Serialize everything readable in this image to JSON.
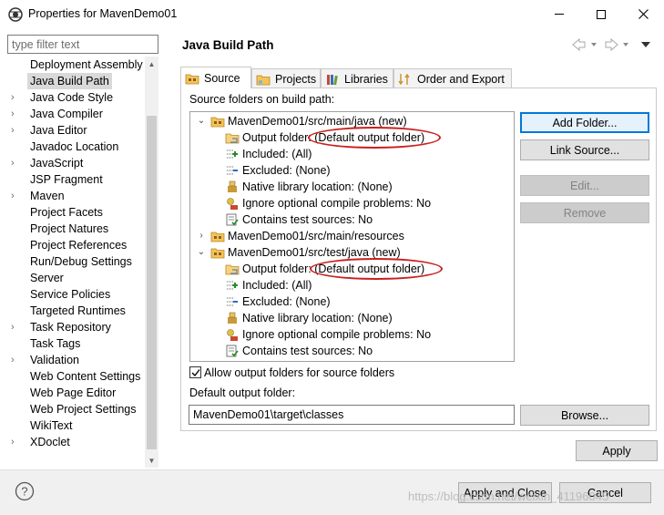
{
  "window": {
    "title": "Properties for MavenDemo01",
    "minimize_glyph": "─",
    "maximize_glyph": "☐",
    "close_glyph": "✕"
  },
  "filter": {
    "placeholder": "type filter text"
  },
  "left_tree": [
    {
      "label": "Deployment Assembly",
      "expandable": false,
      "selected": false
    },
    {
      "label": "Java Build Path",
      "expandable": false,
      "selected": true
    },
    {
      "label": "Java Code Style",
      "expandable": true,
      "selected": false
    },
    {
      "label": "Java Compiler",
      "expandable": true,
      "selected": false
    },
    {
      "label": "Java Editor",
      "expandable": true,
      "selected": false
    },
    {
      "label": "Javadoc Location",
      "expandable": false,
      "selected": false
    },
    {
      "label": "JavaScript",
      "expandable": true,
      "selected": false
    },
    {
      "label": "JSP Fragment",
      "expandable": false,
      "selected": false
    },
    {
      "label": "Maven",
      "expandable": true,
      "selected": false
    },
    {
      "label": "Project Facets",
      "expandable": false,
      "selected": false
    },
    {
      "label": "Project Natures",
      "expandable": false,
      "selected": false
    },
    {
      "label": "Project References",
      "expandable": false,
      "selected": false
    },
    {
      "label": "Run/Debug Settings",
      "expandable": false,
      "selected": false
    },
    {
      "label": "Server",
      "expandable": false,
      "selected": false
    },
    {
      "label": "Service Policies",
      "expandable": false,
      "selected": false
    },
    {
      "label": "Targeted Runtimes",
      "expandable": false,
      "selected": false
    },
    {
      "label": "Task Repository",
      "expandable": true,
      "selected": false
    },
    {
      "label": "Task Tags",
      "expandable": false,
      "selected": false
    },
    {
      "label": "Validation",
      "expandable": true,
      "selected": false
    },
    {
      "label": "Web Content Settings",
      "expandable": false,
      "selected": false
    },
    {
      "label": "Web Page Editor",
      "expandable": false,
      "selected": false
    },
    {
      "label": "Web Project Settings",
      "expandable": false,
      "selected": false
    },
    {
      "label": "WikiText",
      "expandable": false,
      "selected": false
    },
    {
      "label": "XDoclet",
      "expandable": true,
      "selected": false
    }
  ],
  "page": {
    "title": "Java Build Path"
  },
  "tabs": [
    {
      "label": "Source",
      "active": true,
      "icon": "source-folder-icon"
    },
    {
      "label": "Projects",
      "active": false,
      "icon": "projects-icon"
    },
    {
      "label": "Libraries",
      "active": false,
      "icon": "libraries-icon"
    },
    {
      "label": "Order and Export",
      "active": false,
      "icon": "order-export-icon"
    }
  ],
  "source": {
    "label": "Source folders on build path:",
    "rows": [
      {
        "level": 0,
        "expander": "open",
        "icon": "package-folder-icon",
        "text": "MavenDemo01/src/main/java (new)"
      },
      {
        "level": 1,
        "expander": "none",
        "icon": "output-folder-icon",
        "text": "Output folder: (Default output folder)"
      },
      {
        "level": 1,
        "expander": "none",
        "icon": "included-icon",
        "text": "Included: (All)"
      },
      {
        "level": 1,
        "expander": "none",
        "icon": "excluded-icon",
        "text": "Excluded: (None)"
      },
      {
        "level": 1,
        "expander": "none",
        "icon": "native-library-icon",
        "text": "Native library location: (None)"
      },
      {
        "level": 1,
        "expander": "none",
        "icon": "ignore-problems-icon",
        "text": "Ignore optional compile problems: No"
      },
      {
        "level": 1,
        "expander": "none",
        "icon": "test-sources-icon",
        "text": "Contains test sources: No"
      },
      {
        "level": 0,
        "expander": "closed",
        "icon": "package-folder-icon",
        "text": "MavenDemo01/src/main/resources"
      },
      {
        "level": 0,
        "expander": "open",
        "icon": "package-folder-icon",
        "text": "MavenDemo01/src/test/java (new)"
      },
      {
        "level": 1,
        "expander": "none",
        "icon": "output-folder-icon",
        "text": "Output folder: (Default output folder)"
      },
      {
        "level": 1,
        "expander": "none",
        "icon": "included-icon",
        "text": "Included: (All)"
      },
      {
        "level": 1,
        "expander": "none",
        "icon": "excluded-icon",
        "text": "Excluded: (None)"
      },
      {
        "level": 1,
        "expander": "none",
        "icon": "native-library-icon",
        "text": "Native library location: (None)"
      },
      {
        "level": 1,
        "expander": "none",
        "icon": "ignore-problems-icon",
        "text": "Ignore optional compile problems: No"
      },
      {
        "level": 1,
        "expander": "none",
        "icon": "test-sources-icon",
        "text": "Contains test sources: No"
      }
    ]
  },
  "buttons": {
    "add_folder": "Add Folder...",
    "link_source": "Link Source...",
    "edit": "Edit...",
    "remove": "Remove",
    "browse": "Browse...",
    "apply": "Apply",
    "apply_and_close": "Apply and Close",
    "cancel": "Cancel"
  },
  "allow_output": {
    "label": "Allow output folders for source folders",
    "checked": true
  },
  "default_output": {
    "label": "Default output folder:",
    "value": "MavenDemo01\\target\\classes"
  },
  "help": {
    "glyph": "?"
  },
  "watermark": "https://blog.csdn.net/weixin_41196045",
  "colors": {
    "accent": "#0078d7",
    "annotation": "#c8201e",
    "folder": "#e8b339"
  }
}
